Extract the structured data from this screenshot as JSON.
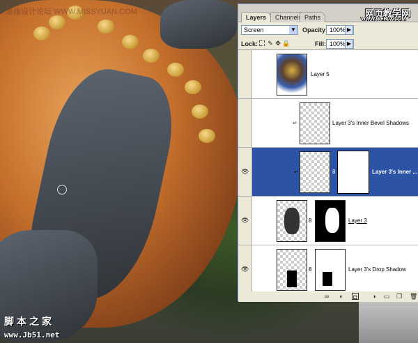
{
  "watermarks": {
    "top_left": "思缘设计论坛 WWW.MISSYUAN.COM",
    "top_right_cn": "网页教学网",
    "top_right_url": "WWW.WEBJX.COM",
    "bottom_left_cn": "脚本之家",
    "bottom_left_url": "www.Jb51.net"
  },
  "panel": {
    "tabs": [
      {
        "label": "Layers",
        "active": true
      },
      {
        "label": "Channels",
        "active": false
      },
      {
        "label": "Paths",
        "active": false
      }
    ],
    "blend_mode": "Screen",
    "opacity_label": "Opacity:",
    "opacity_value": "100%",
    "lock_label": "Lock:",
    "fill_label": "Fill:",
    "fill_value": "100%",
    "layers": [
      {
        "name": "Layer 5",
        "visible": false,
        "selected": false
      },
      {
        "name": "Layer 3's Inner Bevel Shadows",
        "visible": false,
        "selected": false
      },
      {
        "name": "Layer 3's Inner ...",
        "visible": true,
        "selected": true
      },
      {
        "name": "Layer 3",
        "visible": true,
        "selected": false
      },
      {
        "name": "Layer 3's Drop Shadow",
        "visible": true,
        "selected": false
      }
    ],
    "icons": {
      "eye": "👁",
      "arrow": "▶",
      "dropdown": "▼",
      "chain": "8",
      "clip": "↵"
    }
  }
}
